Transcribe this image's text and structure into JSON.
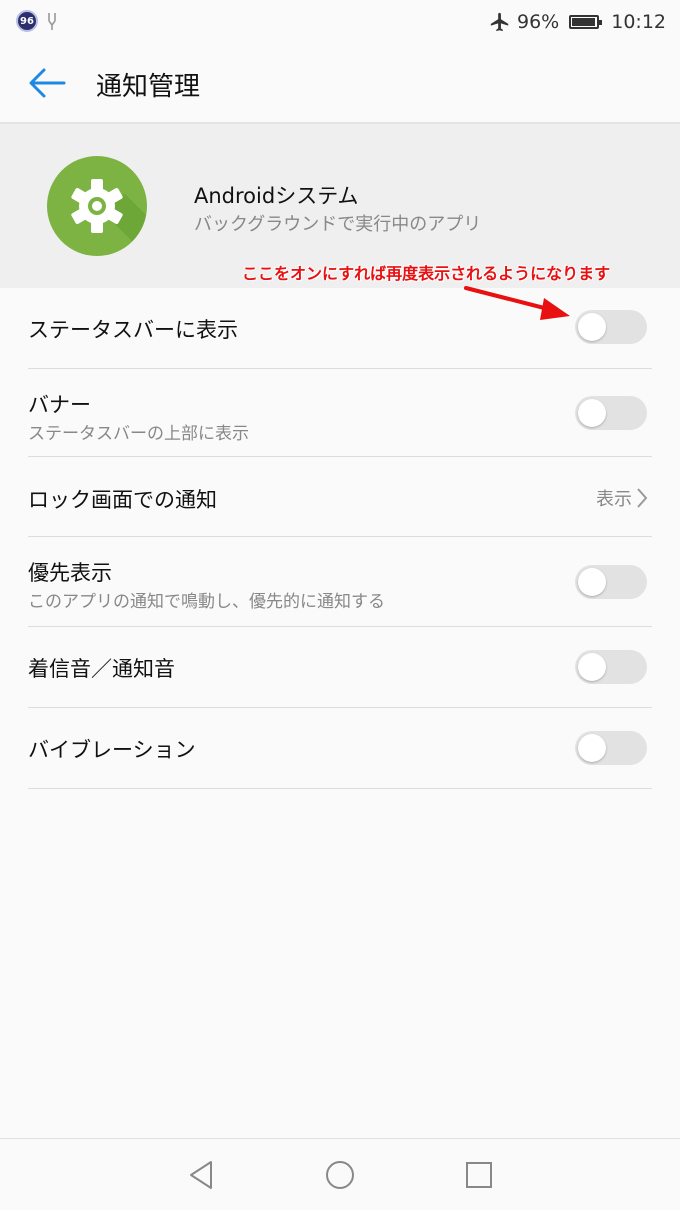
{
  "status_bar": {
    "badge": "96",
    "battery_text": "96%",
    "time": "10:12",
    "icons": [
      "usb-icon",
      "airplane-icon",
      "battery-icon"
    ]
  },
  "app_bar": {
    "title": "通知管理",
    "back_icon": "arrow-left-icon"
  },
  "app_info": {
    "name": "Androidシステム",
    "subtitle": "バックグラウンドで実行中のアプリ",
    "icon": "gear-icon",
    "icon_color": "#7cb342"
  },
  "annotation": {
    "text": "ここをオンにすれば再度表示されるようになります",
    "color": "#e81010"
  },
  "settings": {
    "statusbar": {
      "title": "ステータスバーに表示",
      "enabled": false
    },
    "banner": {
      "title": "バナー",
      "subtitle": "ステータスバーの上部に表示",
      "enabled": false
    },
    "lockscreen": {
      "title": "ロック画面での通知",
      "value": "表示"
    },
    "priority": {
      "title": "優先表示",
      "subtitle": "このアプリの通知で鳴動し、優先的に通知する",
      "enabled": false
    },
    "sound": {
      "title": "着信音／通知音",
      "enabled": false
    },
    "vibration": {
      "title": "バイブレーション",
      "enabled": false
    }
  },
  "nav_bar": {
    "icons": [
      "back-triangle-icon",
      "home-circle-icon",
      "recents-square-icon"
    ]
  },
  "colors": {
    "accent": "#1e88e5",
    "toggle_off": "#e2e2e2",
    "background": "#fafafa"
  }
}
